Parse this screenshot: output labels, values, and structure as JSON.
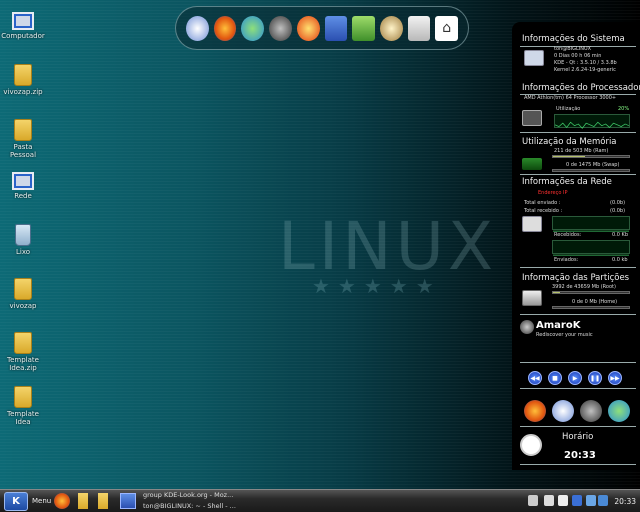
{
  "wallpaper": {
    "logo_text": "LINUX",
    "stars": "★★★★★"
  },
  "desktop_icons": [
    {
      "label": "Computador"
    },
    {
      "label": "vivozap.zip"
    },
    {
      "label": "Pasta Pessoal"
    },
    {
      "label": "Rede"
    },
    {
      "label": "Lixo"
    },
    {
      "label": "vivozap"
    },
    {
      "label": "Template Idea.zip"
    },
    {
      "label": "Template Idea"
    }
  ],
  "dock": {
    "icons": [
      "kde-icon",
      "firefox-icon",
      "messenger-icon",
      "amarok-icon",
      "fire-icon",
      "text-editor-icon",
      "spreadsheet-icon",
      "gimp-icon",
      "drive-icon",
      "home-icon"
    ]
  },
  "panel": {
    "system": {
      "title": "Informações do Sistema",
      "user": "ton@BIGLINUX",
      "uptime": "0 Dias 00 h 06 min",
      "kde": "KDE - Qt : 3.5.10 / 3.3.8b",
      "kernel": "Kernel 2.6.24-19-generic"
    },
    "processor": {
      "title": "Informações do Processador",
      "model": "AMD Athlon(tm) 64 Processor 3000+",
      "usage_label": "Utilização",
      "usage_value": "20%"
    },
    "memory": {
      "title": "Utilização da Memória",
      "ram_text": "211   de   503 Mb (Ram)",
      "swap_text": "0   de  1475 Mb (Swap)",
      "ram_fraction": 0.42,
      "swap_fraction": 0
    },
    "network": {
      "title": "Informações da Rede",
      "ip_label": "Endereço IP",
      "sent_label": "Total enviado :",
      "sent_value": "(0.0b)",
      "received_label": "Total recebido :",
      "received_value": "(0.0b)",
      "rx_label": "Recebidos:",
      "rx_value": "0.0 Kb",
      "tx_label": "Enviados:",
      "tx_value": "0.0 kb"
    },
    "partitions": {
      "title": "Informação das Partições",
      "root_text": "3992   de  43659 Mb (Root)",
      "home_text": "0   de  0 Mb (Home)",
      "root_fraction": 0.09,
      "home_fraction": 0
    },
    "amarok": {
      "name": "AmaroK",
      "tagline": "Rediscover your music"
    },
    "clock": {
      "title": "Horário",
      "time": "20:33"
    }
  },
  "taskbar": {
    "menu_label": "Menu",
    "tasks": [
      "group KDE-Look.org - Moz...",
      "ton@BIGLINUX: ~ - Shell - ..."
    ],
    "time": "20:33"
  },
  "colors": {
    "bar_fill": "#b5c26a",
    "accent_blue": "#2a63c9",
    "ip_red": "#ff3030"
  }
}
